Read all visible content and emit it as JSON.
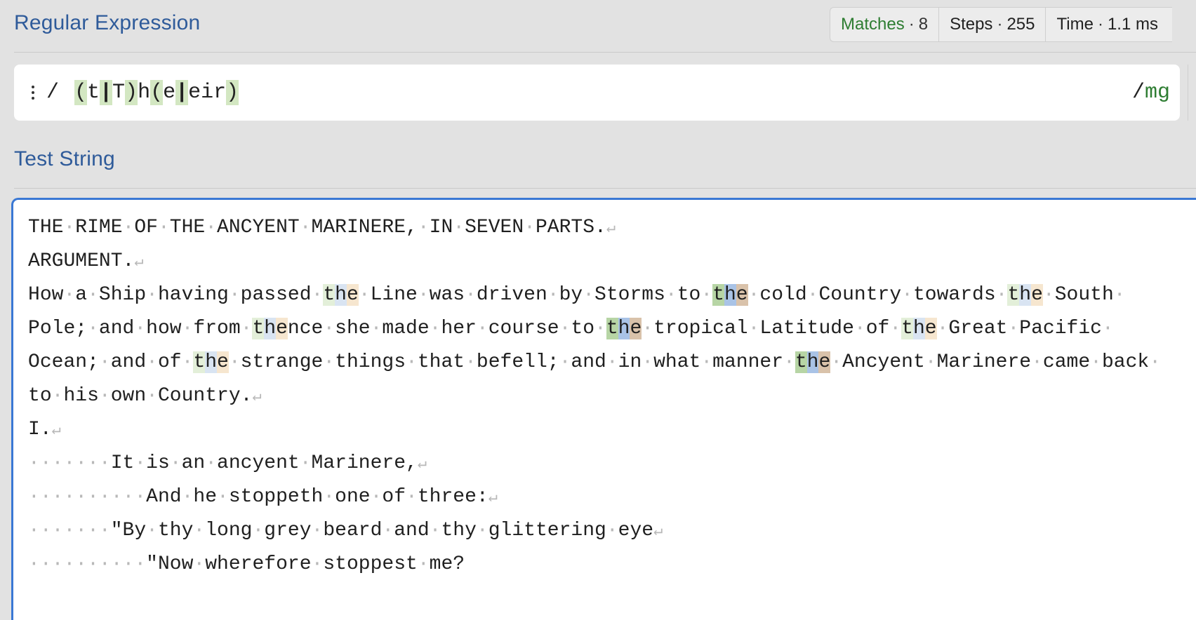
{
  "regex_section": {
    "title": "Regular Expression",
    "stats": {
      "matches_label": "Matches",
      "matches_value": "8",
      "steps_label": "Steps",
      "steps_value": "255",
      "time_label": "Time",
      "time_value": "1.1 ms"
    },
    "delimiter_open": "/",
    "delimiter_close": "/",
    "flags": "mg",
    "pattern_tokens": [
      "(",
      "t",
      "|",
      "T",
      ")",
      "h",
      "(",
      "e",
      "|",
      "eir",
      ")"
    ]
  },
  "test_section": {
    "title": "Test String",
    "lines": [
      "THE RIME OF THE ANCYENT MARINERE, IN SEVEN PARTS.",
      "ARGUMENT.",
      "How a Ship having passed the Line was driven by Storms to the cold Country towards the South ",
      "Pole; and how from thence she made her course to the tropical Latitude of the Great Pacific ",
      "Ocean; and of the strange things that befell; and in what manner the Ancyent Marinere came back ",
      "to his own Country.",
      "I.",
      "       It is an ancyent Marinere,",
      "          And he stoppeth one of three:",
      "       \"By thy long grey beard and thy glittering eye",
      "          \"Now wherefore stoppest me?"
    ]
  },
  "colors": {
    "title_blue": "#2f5b9a",
    "matches_green": "#2e7d32",
    "focus_border": "#3a78d4",
    "token_highlight": "#d3e7c2"
  }
}
